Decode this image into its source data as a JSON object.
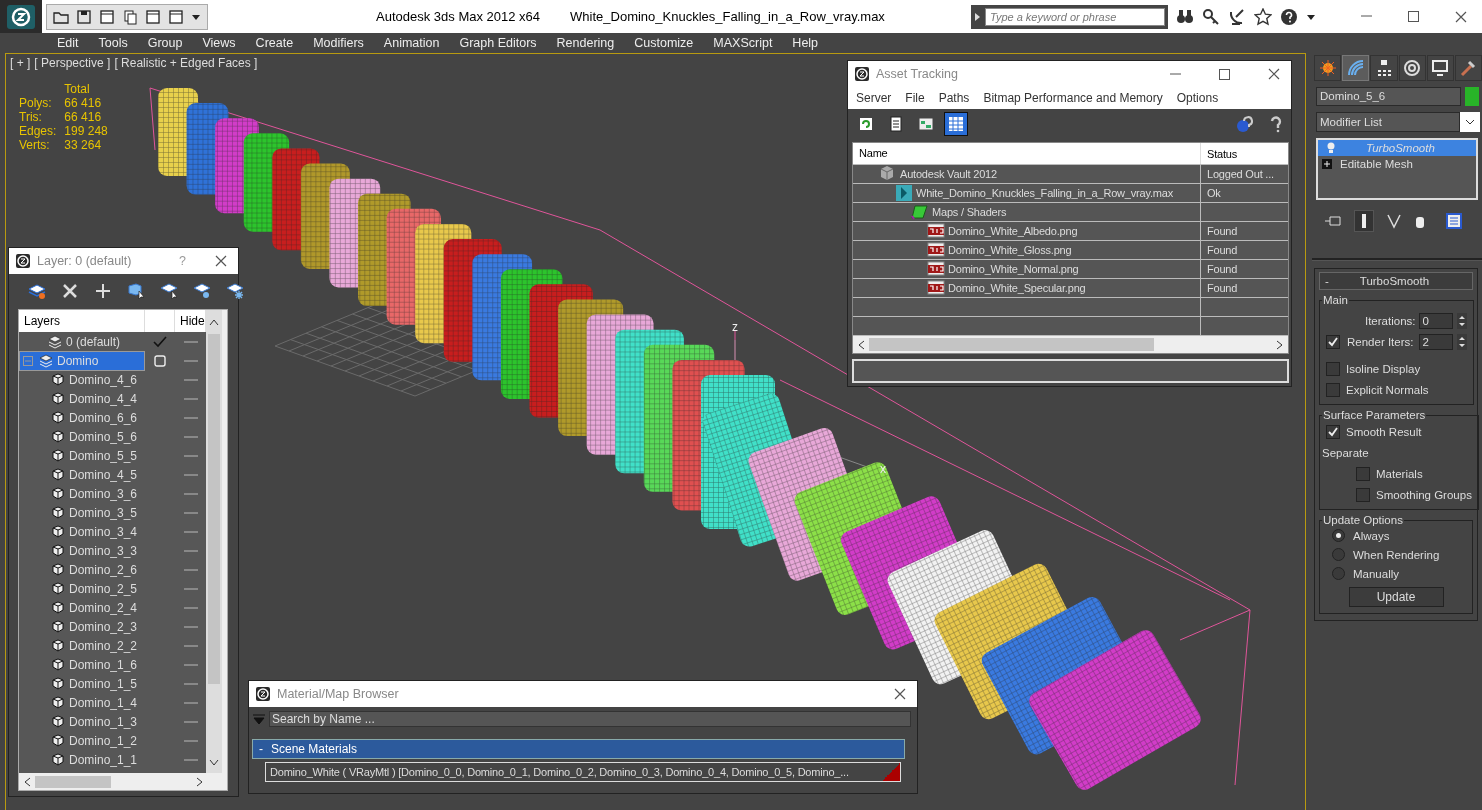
{
  "title_bar": {
    "app": "Autodesk 3ds Max  2012 x64",
    "file": "White_Domino_Knuckles_Falling_in_a_Row_vray.max",
    "search_placeholder": "Type a keyword or phrase"
  },
  "menu": [
    "Edit",
    "Tools",
    "Group",
    "Views",
    "Create",
    "Modifiers",
    "Animation",
    "Graph Editors",
    "Rendering",
    "Customize",
    "MAXScript",
    "Help"
  ],
  "viewport": {
    "labels": [
      "[ + ]",
      "[ Perspective ]",
      "[ Realistic + Edged Faces ]"
    ],
    "stats_header": "Total",
    "stats": [
      {
        "label": "Polys:",
        "value": "66 416"
      },
      {
        "label": "Tris:",
        "value": "66 416"
      },
      {
        "label": "Edges:",
        "value": "199 248"
      },
      {
        "label": "Verts:",
        "value": "33 264"
      }
    ],
    "axis_labels": [
      "z",
      "x"
    ]
  },
  "layer_window": {
    "title": "Layer: 0 (default)",
    "help": "?",
    "columns": [
      "Layers",
      "Hide"
    ],
    "layers": [
      {
        "name": "0 (default)",
        "current": true,
        "selected": false
      },
      {
        "name": "Domino",
        "current": false,
        "selected": true,
        "expanded": true,
        "children": [
          {
            "name": "Domino_4_6"
          },
          {
            "name": "Domino_4_4"
          },
          {
            "name": "Domino_6_6"
          },
          {
            "name": "Domino_5_6"
          },
          {
            "name": "Domino_5_5"
          },
          {
            "name": "Domino_4_5"
          },
          {
            "name": "Domino_3_6"
          },
          {
            "name": "Domino_3_5"
          },
          {
            "name": "Domino_3_4"
          },
          {
            "name": "Domino_3_3"
          },
          {
            "name": "Domino_2_6"
          },
          {
            "name": "Domino_2_5"
          },
          {
            "name": "Domino_2_4"
          },
          {
            "name": "Domino_2_3"
          },
          {
            "name": "Domino_2_2"
          },
          {
            "name": "Domino_1_6"
          },
          {
            "name": "Domino_1_5"
          },
          {
            "name": "Domino_1_4"
          },
          {
            "name": "Domino_1_3"
          },
          {
            "name": "Domino_1_2"
          },
          {
            "name": "Domino_1_1"
          }
        ]
      }
    ]
  },
  "asset_tracking": {
    "title": "Asset Tracking",
    "menu": [
      "Server",
      "File",
      "Paths",
      "Bitmap Performance and Memory",
      "Options"
    ],
    "view_buttons": [
      {
        "selected": false
      },
      {
        "selected": false
      },
      {
        "selected": false
      },
      {
        "selected": true
      }
    ],
    "columns": [
      "Name",
      "Status"
    ],
    "rows": [
      {
        "kind": "vault",
        "name": "Autodesk Vault 2012",
        "status": "Logged Out ...",
        "children": [
          {
            "kind": "scene",
            "name": "White_Domino_Knuckles_Falling_in_a_Row_vray.max",
            "status": "Ok",
            "children": [
              {
                "kind": "folder",
                "name": "Maps / Shaders",
                "children": [
                  {
                    "kind": "image",
                    "name": "Domino_White_Albedo.png",
                    "status": "Found"
                  },
                  {
                    "kind": "image",
                    "name": "Domino_White_Gloss.png",
                    "status": "Found"
                  },
                  {
                    "kind": "image",
                    "name": "Domino_White_Normal.png",
                    "status": "Found"
                  },
                  {
                    "kind": "image",
                    "name": "Domino_White_Specular.png",
                    "status": "Found"
                  }
                ]
              }
            ]
          }
        ]
      }
    ]
  },
  "material_browser": {
    "title": "Material/Map Browser",
    "search_placeholder": "Search by Name ...",
    "sections": [
      {
        "toggle": "-",
        "title": "Scene Materials",
        "items": [
          {
            "name": "Domino_White  ( VRayMtl ) [Domino_0_0, Domino_0_1, Domino_0_2, Domino_0_3, Domino_0_4, Domino_0_5, Domino_..."
          }
        ]
      }
    ]
  },
  "command_panel": {
    "tabs": [
      {
        "selected": false
      },
      {
        "selected": true
      },
      {
        "selected": false
      },
      {
        "selected": false
      },
      {
        "selected": false
      },
      {
        "selected": false
      }
    ],
    "object_name": "Domino_5_6",
    "modifier_list": "Modifier List",
    "stack": [
      {
        "kind": "modifier",
        "name": "TurboSmooth",
        "selected": true
      },
      {
        "kind": "base",
        "name": "Editable Mesh",
        "selected": false
      }
    ],
    "rollout": {
      "toggle": "-",
      "title": "TurboSmooth",
      "groups": [
        {
          "title": "Main",
          "items": [
            {
              "kind": "spinner",
              "label": "Iterations:",
              "value": "0"
            },
            {
              "kind": "check_spinner",
              "label": "Render Iters:",
              "checked": true,
              "value": "2"
            },
            {
              "kind": "checkbox",
              "label": "Isoline Display",
              "checked": false
            },
            {
              "kind": "checkbox",
              "label": "Explicit Normals",
              "checked": false
            }
          ]
        },
        {
          "title": "Surface Parameters",
          "items": [
            {
              "kind": "checkbox",
              "label": "Smooth Result",
              "checked": true
            },
            {
              "kind": "label",
              "label": "Separate"
            },
            {
              "kind": "subcheckbox",
              "label": "Materials",
              "checked": false
            },
            {
              "kind": "subcheckbox",
              "label": "Smoothing Groups",
              "checked": false
            }
          ]
        },
        {
          "title": "Update Options",
          "items": [
            {
              "kind": "radio",
              "label": "Always",
              "selected": true
            },
            {
              "kind": "radio",
              "label": "When Rendering",
              "selected": false
            },
            {
              "kind": "radio",
              "label": "Manually",
              "selected": false
            },
            {
              "kind": "button",
              "label": "Update"
            }
          ]
        }
      ]
    }
  }
}
